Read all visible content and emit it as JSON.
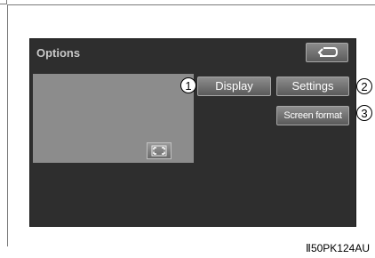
{
  "screen": {
    "title": "Options",
    "back_icon": "back-arrow-icon",
    "fullscreen_icon": "fullscreen-icon"
  },
  "buttons": {
    "display": "Display",
    "settings": "Settings",
    "screen_format": "Screen format"
  },
  "callouts": [
    "1",
    "2",
    "3"
  ],
  "figure_id": "Ⅱ50PK124AU",
  "colors": {
    "screen_bg": "#2e2e2e",
    "preview_bg": "#8c8c8c",
    "button_text": "#ffffff"
  }
}
